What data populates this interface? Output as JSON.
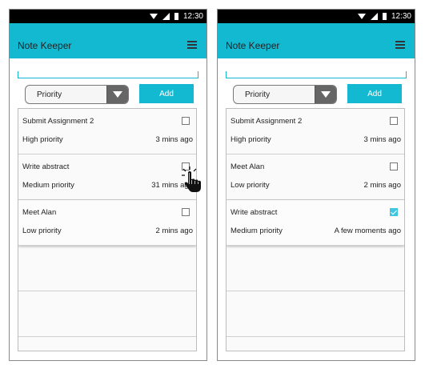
{
  "status_bar": {
    "time": "12:30",
    "icons": [
      "wifi-icon",
      "signal-icon",
      "battery-icon"
    ]
  },
  "phones": [
    {
      "app_title": "Note Keeper",
      "note_input": {
        "value": ""
      },
      "priority_select": {
        "value": "Priority"
      },
      "add_label": "Add",
      "notes": [
        {
          "title": "Submit Assignment 2",
          "priority": "High priority",
          "time": "3 mins ago",
          "checked": false
        },
        {
          "title": "Write abstract",
          "priority": "Medium priority",
          "time": "31 mins ago",
          "checked": false
        },
        {
          "title": "Meet Alan",
          "priority": "Low priority",
          "time": "2 mins ago",
          "checked": false
        }
      ]
    },
    {
      "app_title": "Note Keeper",
      "note_input": {
        "value": ""
      },
      "priority_select": {
        "value": "Priority"
      },
      "add_label": "Add",
      "notes": [
        {
          "title": "Submit Assignment 2",
          "priority": "High priority",
          "time": "3 mins ago",
          "checked": false
        },
        {
          "title": "Meet Alan",
          "priority": "Low priority",
          "time": "2 mins ago",
          "checked": false
        },
        {
          "title": "Write abstract",
          "priority": "Medium priority",
          "time": "A few moments ago",
          "checked": true
        }
      ]
    }
  ],
  "colors": {
    "accent": "#13b8d1",
    "status_bar": "#000000",
    "dropdown": "#666666"
  },
  "cursor": "hand-pointer-icon"
}
